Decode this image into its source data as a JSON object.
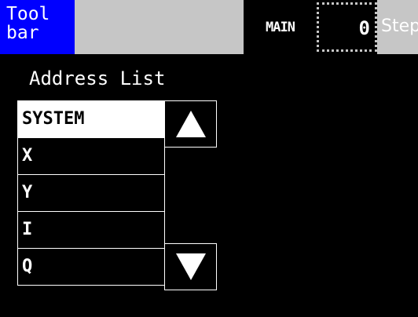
{
  "toolbar": {
    "label": "Tool\nbar",
    "color": "#0000ff"
  },
  "status": {
    "program": "MAIN",
    "step_value": "0",
    "step_label": "Step"
  },
  "address_list": {
    "title": "Address List",
    "items": [
      {
        "label": "SYSTEM",
        "selected": true
      },
      {
        "label": "X",
        "selected": false
      },
      {
        "label": "Y",
        "selected": false
      },
      {
        "label": "I",
        "selected": false
      },
      {
        "label": "Q",
        "selected": false
      }
    ],
    "scroll_up_icon": "triangle-up-icon",
    "scroll_down_icon": "triangle-down-icon"
  }
}
